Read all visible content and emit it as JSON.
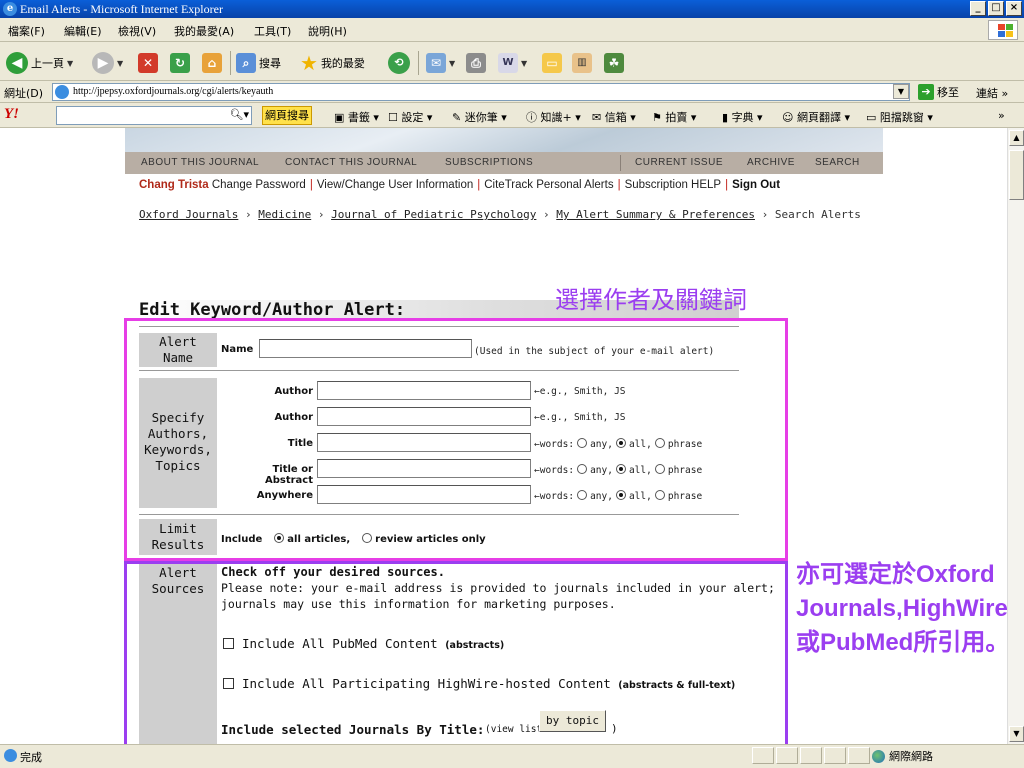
{
  "window": {
    "title": "Email Alerts - Microsoft Internet Explorer",
    "min": "_",
    "max": "□",
    "close": "×"
  },
  "menu": [
    "檔案(F)",
    "編輯(E)",
    "檢視(V)",
    "我的最愛(A)",
    "工具(T)",
    "說明(H)"
  ],
  "toolbar": {
    "back": "上一頁",
    "search": "搜尋",
    "favorites": "我的最愛"
  },
  "address": {
    "label": "網址(D)",
    "url": "http://jpepsy.oxfordjournals.org/cgi/alerts/keyauth",
    "go": "移至",
    "links": "連結"
  },
  "yahoo": {
    "logo": "Y!",
    "search_button": "網頁搜尋",
    "tools": [
      "書籤",
      "設定",
      "迷你筆",
      "知識+",
      "信箱",
      "拍賣",
      "字典",
      "網頁翻譯",
      "阻擋跳窗"
    ],
    "more": "»"
  },
  "site_nav": {
    "left": [
      "ABOUT THIS JOURNAL",
      "CONTACT THIS JOURNAL",
      "SUBSCRIPTIONS"
    ],
    "right": [
      "CURRENT ISSUE",
      "ARCHIVE",
      "SEARCH"
    ]
  },
  "user_bar": {
    "user": "Chang Trista",
    "links": [
      "Change Password",
      "View/Change User Information",
      "CiteTrack Personal Alerts",
      "Subscription HELP"
    ],
    "signout": "Sign Out"
  },
  "breadcrumb": {
    "items": [
      "Oxford Journals",
      "Medicine",
      "Journal of Pediatric Psychology",
      "My Alert Summary & Preferences"
    ],
    "current": "Search Alerts",
    "sep": "›"
  },
  "heading": "Edit Keyword/Author Alert:",
  "alert_name": {
    "side": [
      "Alert",
      "Name"
    ],
    "label": "Name",
    "value": "",
    "hint": "(Used in the subject of your e-mail alert)"
  },
  "specify": {
    "side": [
      "Specify",
      "Authors,",
      "Keywords,",
      "Topics"
    ],
    "rows": [
      {
        "label": "Author",
        "hint": "e.g., Smith, JS"
      },
      {
        "label": "Author",
        "hint": "e.g., Smith, JS"
      },
      {
        "label": "Title",
        "hint": "words:"
      },
      {
        "label": "Title or Abstract",
        "hint": "words:"
      },
      {
        "label": "Anywhere",
        "hint": "words:"
      }
    ],
    "options": {
      "any": "any,",
      "all": "all,",
      "phrase": "phrase"
    },
    "arrow": "←"
  },
  "limit": {
    "side": [
      "Limit",
      "Results"
    ],
    "include": "Include",
    "all_articles": "all articles,",
    "review_only": "review articles only"
  },
  "sources": {
    "side": [
      "Alert",
      "Sources"
    ],
    "title": "Check off your desired sources.",
    "note1": "Please note: your e-mail address is provided to journals included in your alert;",
    "note2": "journals may use this information for marketing purposes.",
    "pubmed": "Include All PubMed Content",
    "pubmed_small": "(abstracts)",
    "highwire": "Include All Participating HighWire-hosted Content",
    "highwire_small": "(abstracts & full-text)",
    "by_title": "Include selected Journals By Title:",
    "view_list": "(view list",
    "by_topic": "by topic",
    "close_paren": ")"
  },
  "annotations": {
    "top": "選擇作者及關鍵詞",
    "side": "亦可選定於Oxford Journals,HighWire或PubMed所引用。"
  },
  "status": {
    "text": "完成",
    "zone": "網際網路"
  },
  "colors": {
    "annotation_magenta": "#e63ee6",
    "annotation_violet": "#9b3ef0",
    "user_red": "#b02a1a"
  }
}
